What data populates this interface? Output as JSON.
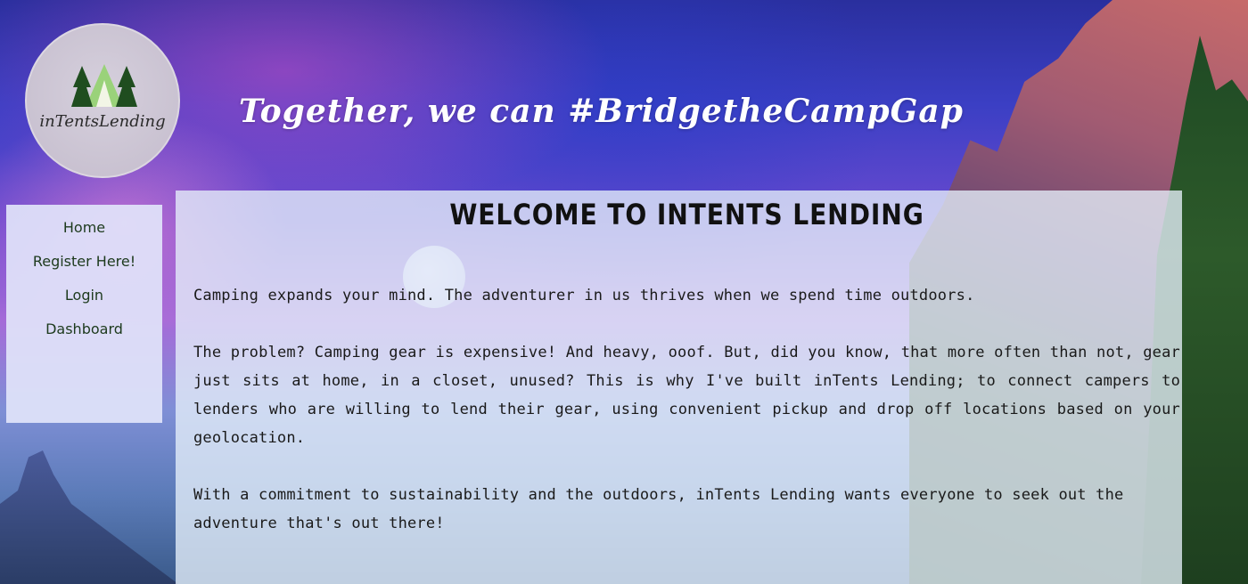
{
  "logo": {
    "text": "inTentsLending",
    "colors": {
      "trees": "#1f4d1f",
      "tent": "#9ad27a"
    }
  },
  "header": {
    "tagline": "Together, we can #BridgetheCampGap"
  },
  "nav": {
    "items": [
      {
        "label": "Home"
      },
      {
        "label": "Register Here!"
      },
      {
        "label": "Login"
      },
      {
        "label": "Dashboard"
      }
    ]
  },
  "main": {
    "title": "WELCOME TO INTENTS LENDING",
    "paragraphs": [
      "Camping expands your mind. The adventurer in us thrives when we spend time outdoors.",
      "The problem? Camping gear is expensive! And heavy, ooof. But, did you know, that more often than not, gear just sits at home, in a closet, unused? This is why I've built inTents Lending; to connect campers to lenders who are willing to lend their gear, using convenient pickup and drop off locations based on your geolocation.",
      "With a commitment to sustainability and the outdoors, inTents Lending wants everyone to seek out the adventure that's out there!"
    ]
  },
  "colors": {
    "panel": "#e6f0fa",
    "nav_text": "#1d3a1d",
    "tagline": "#ffffff"
  }
}
